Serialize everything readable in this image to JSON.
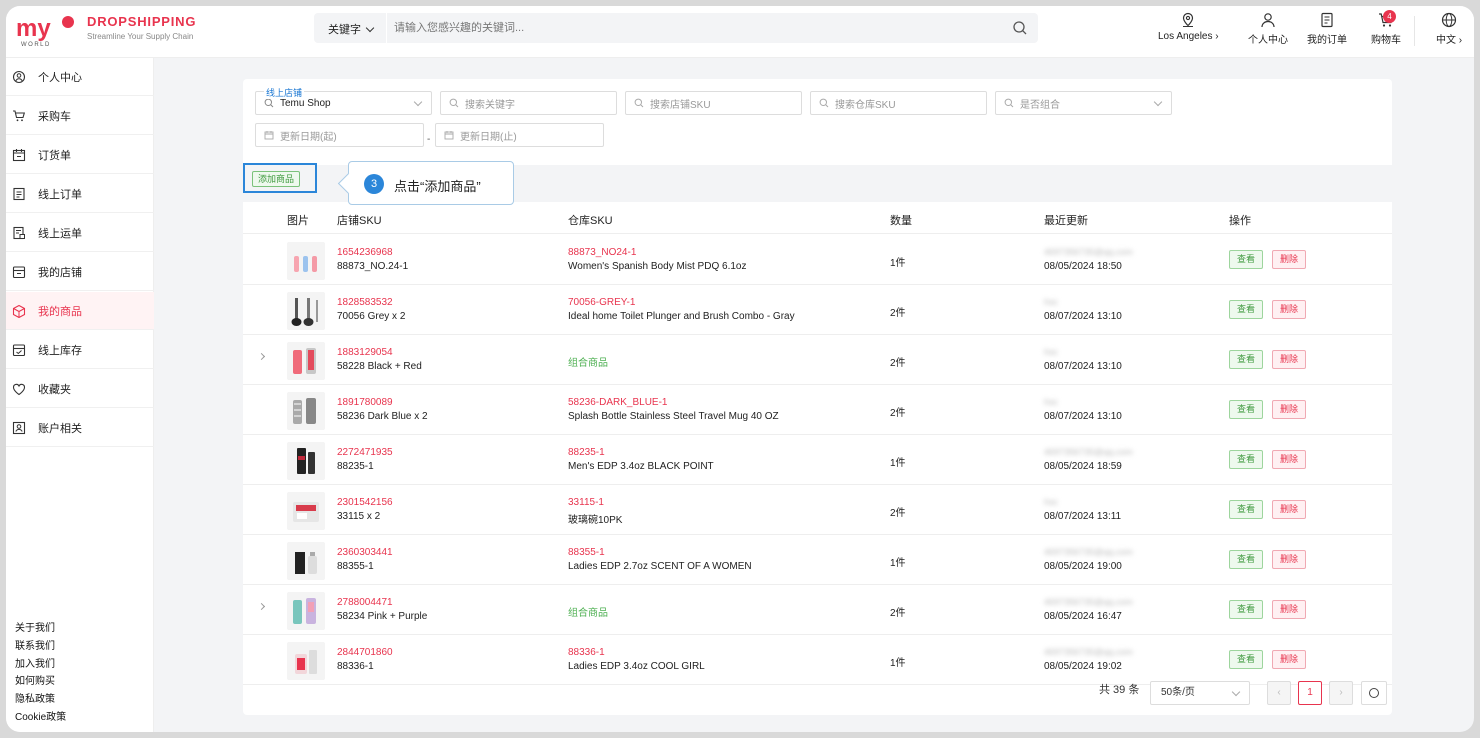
{
  "header": {
    "brand_title": "DROPSHIPPING",
    "brand_sub": "Streamline Your Supply Chain",
    "logo_text": "my WORLD",
    "search_type": "关键字",
    "search_placeholder": "请输入您感兴趣的关键词...",
    "location": "Los Angeles",
    "account": "个人中心",
    "orders": "我的订单",
    "cart": "购物车",
    "cart_count": "4",
    "language": "中文"
  },
  "sidebar": {
    "items": [
      {
        "label": "个人中心",
        "icon": "user-circle-icon"
      },
      {
        "label": "采购车",
        "icon": "cart-icon"
      },
      {
        "label": "订货单",
        "icon": "calendar-icon"
      },
      {
        "label": "线上订单",
        "icon": "list-icon"
      },
      {
        "label": "线上运单",
        "icon": "waybill-icon"
      },
      {
        "label": "我的店铺",
        "icon": "store-icon"
      },
      {
        "label": "我的商品",
        "icon": "box-icon"
      },
      {
        "label": "线上库存",
        "icon": "inventory-icon"
      },
      {
        "label": "收藏夹",
        "icon": "heart-icon"
      },
      {
        "label": "账户相关",
        "icon": "account-icon"
      }
    ],
    "active_index": 6,
    "footer_links": [
      "关于我们",
      "联系我们",
      "加入我们",
      "如何购买",
      "隐私政策",
      "Cookie政策"
    ]
  },
  "filters": {
    "store_label": "线上店铺",
    "store_value": "Temu Shop",
    "keyword_placeholder": "搜索关键字",
    "store_sku_placeholder": "搜索店铺SKU",
    "warehouse_sku_placeholder": "搜索仓库SKU",
    "combo_placeholder": "是否组合",
    "date_start_placeholder": "更新日期(起)",
    "date_end_placeholder": "更新日期(止)",
    "date_separator": "-"
  },
  "toolbar": {
    "add_label": "添加商品",
    "tip_number": "3",
    "tip_text": "点击“添加商品”"
  },
  "table": {
    "headers": {
      "image": "图片",
      "store_sku": "店铺SKU",
      "warehouse_sku": "仓库SKU",
      "qty": "数量",
      "updated": "最近更新",
      "actions": "操作"
    },
    "view_label": "查看",
    "delete_label": "删除",
    "rows": [
      {
        "sku_id": "1654236968",
        "sku_name": "88873_NO.24-1",
        "wh_code": "88873_NO24-1",
        "wh_name": "Women's Spanish Body Mist PDQ 6.1oz",
        "combo": false,
        "expand": false,
        "qty": "1件",
        "who": "4697356735@qq.com",
        "date": "08/05/2024 18:50"
      },
      {
        "sku_id": "1828583532",
        "sku_name": "70056 Grey x 2",
        "wh_code": "70056-GREY-1",
        "wh_name": "Ideal home Toilet Plunger and Brush Combo - Gray",
        "combo": false,
        "expand": false,
        "qty": "2件",
        "who": "hsc",
        "date": "08/07/2024 13:10"
      },
      {
        "sku_id": "1883129054",
        "sku_name": "58228 Black + Red",
        "wh_code": "组合商品",
        "wh_name": "",
        "combo": true,
        "expand": true,
        "qty": "2件",
        "who": "hsc",
        "date": "08/07/2024 13:10"
      },
      {
        "sku_id": "1891780089",
        "sku_name": "58236 Dark Blue x 2",
        "wh_code": "58236-DARK_BLUE-1",
        "wh_name": "Splash Bottle Stainless Steel Travel Mug 40 OZ",
        "combo": false,
        "expand": false,
        "qty": "2件",
        "who": "hsc",
        "date": "08/07/2024 13:10"
      },
      {
        "sku_id": "2272471935",
        "sku_name": "88235-1",
        "wh_code": "88235-1",
        "wh_name": "Men's EDP 3.4oz BLACK POINT",
        "combo": false,
        "expand": false,
        "qty": "1件",
        "who": "4697356735@qq.com",
        "date": "08/05/2024 18:59"
      },
      {
        "sku_id": "2301542156",
        "sku_name": "33115 x 2",
        "wh_code": "33115-1",
        "wh_name": "玻璃碗10PK",
        "combo": false,
        "expand": false,
        "qty": "2件",
        "who": "hsc",
        "date": "08/07/2024 13:11"
      },
      {
        "sku_id": "2360303441",
        "sku_name": "88355-1",
        "wh_code": "88355-1",
        "wh_name": "Ladies EDP 2.7oz SCENT OF A WOMEN",
        "combo": false,
        "expand": false,
        "qty": "1件",
        "who": "4697356735@qq.com",
        "date": "08/05/2024 19:00"
      },
      {
        "sku_id": "2788004471",
        "sku_name": "58234 Pink + Purple",
        "wh_code": "组合商品",
        "wh_name": "",
        "combo": true,
        "expand": true,
        "qty": "2件",
        "who": "4697356735@qq.com",
        "date": "08/05/2024 16:47"
      },
      {
        "sku_id": "2844701860",
        "sku_name": "88336-1",
        "wh_code": "88336-1",
        "wh_name": "Ladies EDP 3.4oz COOL GIRL",
        "combo": false,
        "expand": false,
        "qty": "1件",
        "who": "4697356735@qq.com",
        "date": "08/05/2024 19:02"
      }
    ]
  },
  "pagination": {
    "total": "共 39 条",
    "page_size": "50条/页",
    "current_page": "1"
  },
  "colors": {
    "brand": "#e8344e",
    "combo": "#4caf50",
    "highlight": "#2b86d9"
  }
}
